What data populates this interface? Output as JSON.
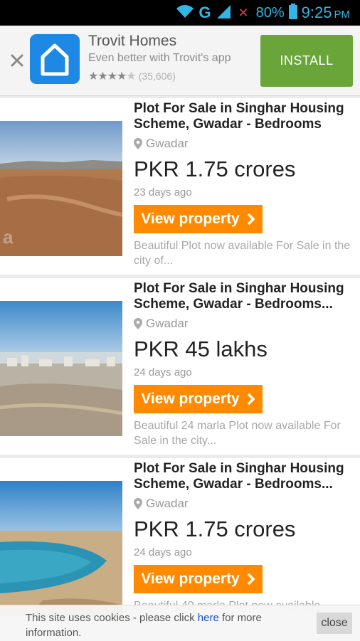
{
  "status_bar": {
    "network": "G",
    "battery": "80%",
    "time": "9:25",
    "ampm": "PM"
  },
  "app_banner": {
    "title": "Trovit Homes",
    "subtitle": "Even better with Trovit's app",
    "rating_count": "(35,606)",
    "stars": 4.5,
    "install_label": "INSTALL"
  },
  "listings": [
    {
      "title": "Plot For Sale in Singhar Housing Scheme, Gwadar - Bedrooms",
      "location": "Gwadar",
      "price": "PKR 1.75 crores",
      "posted": "23 days ago",
      "button": "View property",
      "description": "Beautiful Plot now available For Sale in the city of...",
      "watermark": "a"
    },
    {
      "title": "Plot For Sale in Singhar Housing Scheme, Gwadar - Bedrooms...",
      "location": "Gwadar",
      "price": "PKR 45 lakhs",
      "posted": "24 days ago",
      "button": "View property",
      "description": "Beautiful 24 marla Plot now available For Sale in the city..."
    },
    {
      "title": "Plot For Sale in Singhar Housing Scheme, Gwadar - Bedrooms...",
      "location": "Gwadar",
      "price": "PKR 1.75 crores",
      "posted": "24 days ago",
      "button": "View property",
      "description": "Beautiful 40 marla Plot now available"
    }
  ],
  "cookie_notice": {
    "text_before": "This site uses cookies - please click ",
    "link": "here",
    "text_after": " for more information.",
    "close_label": "close"
  },
  "colors": {
    "accent_orange": "#ff8a00",
    "install_green": "#6aa53a",
    "logo_blue": "#1e88e5"
  }
}
